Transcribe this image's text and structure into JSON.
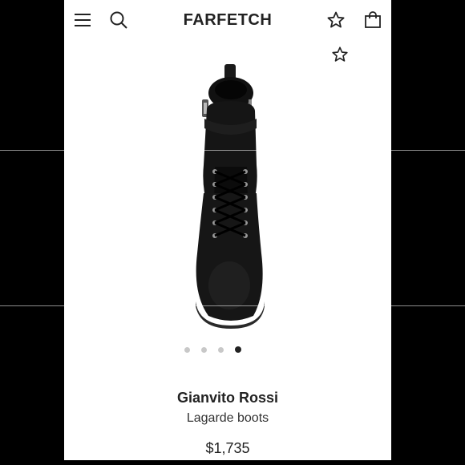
{
  "header": {
    "logo": "FARFETCH",
    "menu_icon": "hamburger-menu-icon",
    "search_icon": "search-icon",
    "wishlist_icon": "star-icon",
    "bag_icon": "shopping-bag-icon"
  },
  "product": {
    "favorite_icon": "star-icon",
    "brand": "Gianvito Rossi",
    "name": "Lagarde boots",
    "price": "$1,735",
    "image_carousel": {
      "total_images": 4,
      "active_index": 3
    }
  },
  "colors": {
    "text_dark": "#222222",
    "background": "#ffffff",
    "frame": "#000000",
    "dot_inactive": "#c8c8c8",
    "dot_active": "#222222"
  }
}
